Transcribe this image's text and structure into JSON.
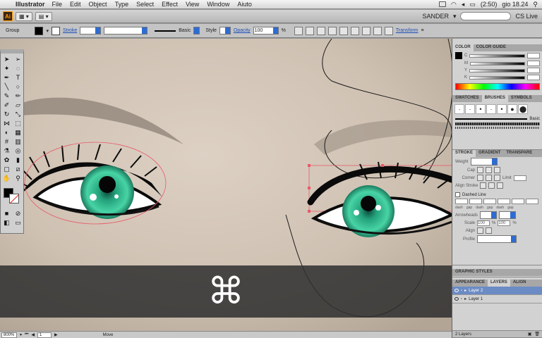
{
  "menubar": {
    "app_name": "Illustrator",
    "menus": [
      "File",
      "Edit",
      "Object",
      "Type",
      "Select",
      "Effect",
      "View",
      "Window",
      "Aiuto"
    ],
    "battery": "(2:50)",
    "clock": "gio 18.24"
  },
  "appbar": {
    "logo": "Ai",
    "user": "SANDER",
    "cs_live": "CS Live"
  },
  "controlbar": {
    "selection_type": "Group",
    "stroke_label": "Stroke",
    "brush_name": "Basic",
    "style_label": "Style",
    "opacity_label": "Opacity",
    "opacity_value": "100",
    "opacity_unit": "%",
    "transform_label": "Transform"
  },
  "overlay": {
    "key_symbol": "⌘"
  },
  "statusbar": {
    "zoom": "800%",
    "page": "1",
    "tool_name": "Move"
  },
  "panels": {
    "color_tab": "COLOR",
    "color_guide_tab": "COLOR GUIDE",
    "swatches_tab": "SWATCHES",
    "brushes_tab": "BRUSHES",
    "symbols_tab": "SYMBOLS",
    "brush_basic": "Basic",
    "stroke_tab": "STROKE",
    "gradient_tab": "GRADIENT",
    "transparency_tab": "TRANSPARE",
    "weight_label": "Weight",
    "cap_label": "Cap",
    "corner_label": "Corner",
    "limit_label": "Limit",
    "align_stroke_label": "Align Stroke",
    "dashed_line_label": "Dashed Line",
    "dash_labels": [
      "dash",
      "gap",
      "dash",
      "gap",
      "dash",
      "gap"
    ],
    "arrowheads_label": "Arrowheads",
    "scale_label": "Scale",
    "scale_values": [
      "100",
      "%",
      "100",
      "%"
    ],
    "align_label": "Align",
    "profile_label": "Profile",
    "graphic_styles_tab": "GRAPHIC STYLES",
    "appearance_tab": "APPEARANCE",
    "layers_tab": "LAYERS",
    "align_tab": "ALIGN",
    "layers": [
      "Layer 2",
      "Layer 1"
    ],
    "layers_count": "2 Layers"
  },
  "colors": {
    "iris": "#2fb58c",
    "selection_red": "#e85a6a",
    "skin": "#d8cbbd",
    "spectrum_accent": "#2d6cd2"
  }
}
